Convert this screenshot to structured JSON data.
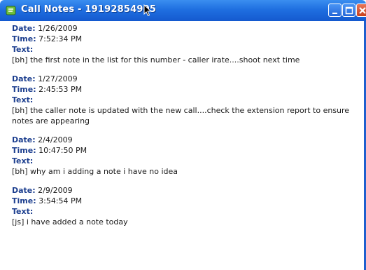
{
  "window": {
    "title": "Call Notes - 19192854905",
    "app_icon": "call-notes-app-icon",
    "buttons": {
      "minimize": "minimize-icon",
      "maximize": "maximize-icon",
      "close": "close-icon"
    }
  },
  "field_labels": {
    "date": "Date:",
    "time": "Time:",
    "text": "Text:"
  },
  "notes": [
    {
      "date": "1/26/2009",
      "time": "7:52:34 PM",
      "text": "[bh] the first note in the list for this number - caller irate....shoot next time"
    },
    {
      "date": "1/27/2009",
      "time": "2:45:53 PM",
      "text": "[bh] the caller note is updated with the new call....check the extension report to ensure notes are appearing"
    },
    {
      "date": "2/4/2009",
      "time": "10:47:50 PM",
      "text": "[bh] why am i adding a note i have no idea"
    },
    {
      "date": "2/9/2009",
      "time": "3:54:54 PM",
      "text": "[js] i have added a note today"
    }
  ]
}
